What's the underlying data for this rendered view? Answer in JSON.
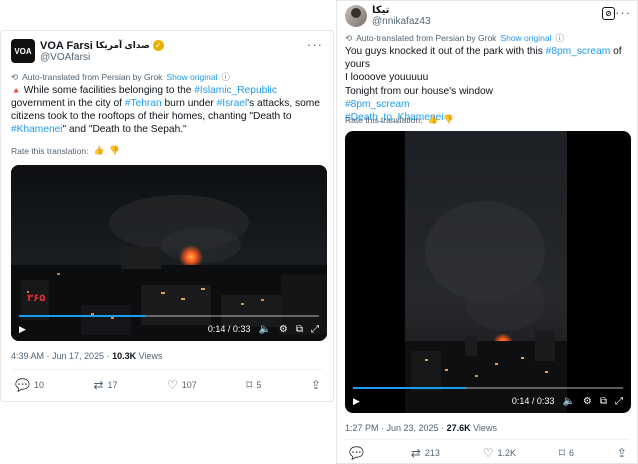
{
  "left": {
    "author_name": "VOA Farsi",
    "author_name_fa": "صدای آمریکا",
    "handle": "@VOAfarsi",
    "avatar_text": "VOA",
    "translated_note": "Auto-translated from Persian by Grok",
    "show_original": "Show original",
    "text": {
      "warn": "🔺",
      "p1": " While some facilities belonging to the ",
      "t1": "#Islamic_Republic",
      "p2": " government in the city of ",
      "t2": "#Tehran",
      "p3": " burn under ",
      "t3": "#Israel",
      "p4": "'s attacks, some citizens took to the rooftops of their homes, chanting \"Death to ",
      "t4": "#Khamenei",
      "p5": "\" and \"Death to the Sepah.\""
    },
    "rate_label": "Rate this translation:",
    "video": {
      "watermark": "۳۶۵",
      "time": "0:14 / 0:33",
      "progress": 0.42
    },
    "meta": {
      "time": "4:39 AM · Jun 17, 2025 · ",
      "views_count": "10.3K",
      "views_label": " Views"
    },
    "actions": {
      "replies": "10",
      "reposts": "17",
      "likes": "107",
      "bookmarks": "5"
    }
  },
  "right": {
    "author_name": "تیکا",
    "handle": "@nnikafaz43",
    "translated_note": "Auto-translated from Persian by Grok",
    "show_original": "Show original",
    "text": {
      "l1a": "You guys knocked it out of the park with this ",
      "l1tag": "#8pm_scream",
      "l1b": " of yours",
      "l2": "I loooove youuuuu",
      "l3": "Tonight from our house's window",
      "l4": "#8pm_scream",
      "l5": "#Death_to_Khamenei"
    },
    "rate_label": "Rate this translation:",
    "video": {
      "time": "0:14 / 0:33",
      "progress": 0.42
    },
    "meta": {
      "time": "1:27 PM · Jun 23, 2025 · ",
      "views_count": "27.6K",
      "views_label": " Views"
    },
    "actions": {
      "replies": "",
      "reposts": "213",
      "likes": "1.2K",
      "bookmarks": "6"
    }
  },
  "colors": {
    "link": "#1d9bf0",
    "muted": "#536471",
    "text": "#0f1419",
    "verified": "#e8b100"
  },
  "icons": [
    "voa-logo",
    "verified-badge",
    "more-icon",
    "translate-icon",
    "info-icon",
    "thumb-up-icon",
    "thumb-down-icon",
    "play-icon",
    "mute-icon",
    "settings-icon",
    "pip-icon",
    "fullscreen-icon",
    "reply-icon",
    "repost-icon",
    "like-icon",
    "bookmark-icon",
    "share-icon",
    "grok-icon"
  ]
}
